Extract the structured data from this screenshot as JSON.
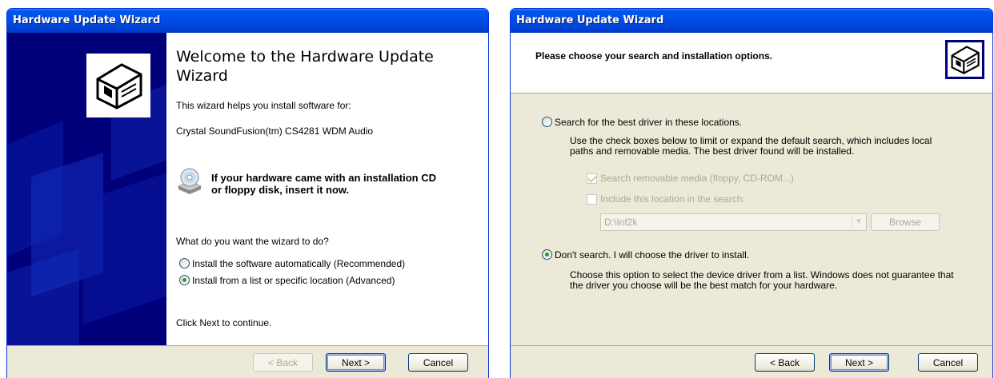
{
  "welcome_window": {
    "title": "Hardware Update Wizard",
    "heading": "Welcome to the Hardware Update Wizard",
    "intro": "This wizard helps you install software for:",
    "device_name": "Crystal SoundFusion(tm) CS4281 WDM Audio",
    "cd_prompt_line1": "If your hardware came with an installation CD",
    "cd_prompt_line2": "or floppy disk, insert it now.",
    "question": "What do you want the wizard to do?",
    "options": [
      {
        "label": "Install the software automatically (Recommended)",
        "selected": false
      },
      {
        "label": "Install from a list or specific location (Advanced)",
        "selected": true
      }
    ],
    "continue_text": "Click Next to continue.",
    "buttons": {
      "back": "< Back",
      "next": "Next >",
      "cancel": "Cancel"
    }
  },
  "options_window": {
    "title": "Hardware Update Wizard",
    "header": "Please choose your search and installation options.",
    "search_option": {
      "label": "Search for the best driver in these locations.",
      "selected": false,
      "description_line1": "Use the check boxes below to limit or expand the default search, which includes local",
      "description_line2": "paths and removable media. The best driver found will be installed.",
      "removable_media": {
        "label": "Search removable media (floppy, CD-ROM...)",
        "checked": true
      },
      "include_location": {
        "label": "Include this location in the search:",
        "checked": false
      },
      "path_value": "D:\\Inf2k",
      "browse_label": "Browse"
    },
    "choose_option": {
      "label": "Don't search. I will choose the driver to install.",
      "selected": true,
      "description_line1": "Choose this option to select the device driver from a list.  Windows does not guarantee that",
      "description_line2": "the driver you choose will be the best match for your hardware."
    },
    "buttons": {
      "back": "< Back",
      "next": "Next >",
      "cancel": "Cancel"
    }
  },
  "colors": {
    "title_bar": "#0054e3",
    "dialog_face": "#ece9d8",
    "banner": "#00007a",
    "radio_dot": "#21a121"
  }
}
